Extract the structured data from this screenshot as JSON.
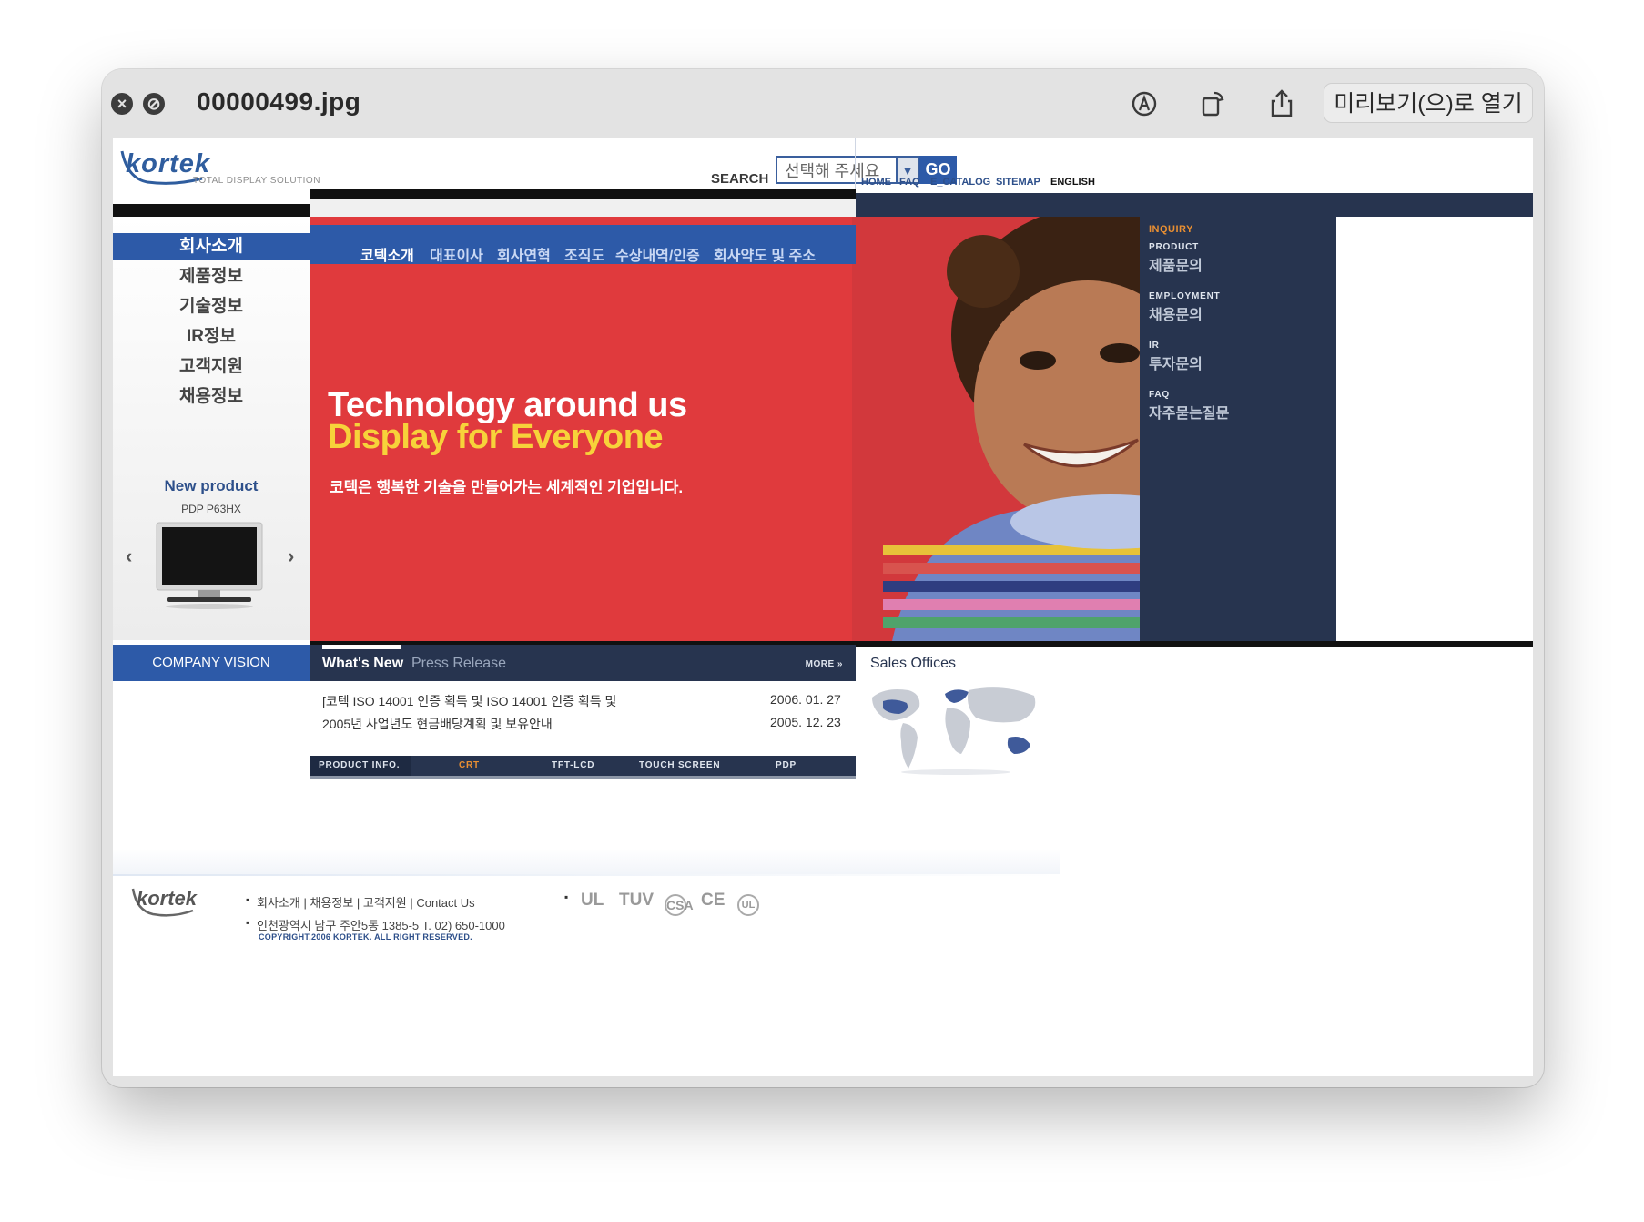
{
  "window": {
    "title": "00000499.jpg",
    "open_button": "미리보기(으)로 열기"
  },
  "header": {
    "logo": "kortek",
    "tagline": "TOTAL DISPLAY SOLUTION",
    "search_label": "SEARCH",
    "search_value": "선택해 주세요",
    "go_label": "GO",
    "links": [
      "HOME",
      "FAQ",
      "E_CATALOG",
      "SITEMAP",
      "ENGLISH"
    ]
  },
  "leftnav": {
    "items": [
      "회사소개",
      "제품정보",
      "기술정보",
      "IR정보",
      "고객지원",
      "채용정보"
    ],
    "active_index": 0,
    "new_product_title": "New product",
    "new_product_model": "PDP P63HX",
    "prev": "‹",
    "next": "›"
  },
  "hero": {
    "tabs": [
      "코텍소개",
      "대표이사",
      "회사연혁",
      "조직도",
      "수상내역/인증",
      "회사약도 및 주소"
    ],
    "headline_1": "Technology around us",
    "headline_2": "Display for Everyone",
    "subline": "코텍은 행복한 기술을 만들어가는 세계적인 기업입니다."
  },
  "inquiry": {
    "heading": "INQUIRY",
    "items": [
      {
        "en": "PRODUCT",
        "ko": "제품문의"
      },
      {
        "en": "EMPLOYMENT",
        "ko": "채용문의"
      },
      {
        "en": "IR",
        "ko": "투자문의"
      },
      {
        "en": "FAQ",
        "ko": "자주묻는질문"
      }
    ]
  },
  "vision": {
    "label": "COMPANY VISION"
  },
  "news": {
    "tab_active": "What's New",
    "tab_other": "Press Release",
    "more": "MORE »",
    "items": [
      {
        "title": "[코텍 ISO 14001 인증 획득 및 ISO 14001 인증 획득 및",
        "date": "2006. 01. 27"
      },
      {
        "title": "2005년 사업년도 현금배당계획 및 보유안내",
        "date": "2005. 12. 23"
      }
    ]
  },
  "product_bar": {
    "label": "PRODUCT INFO.",
    "items": [
      "CRT",
      "TFT-LCD",
      "TOUCH SCREEN",
      "PDP"
    ],
    "selected": "CRT"
  },
  "sales": {
    "title": "Sales Offices"
  },
  "footer": {
    "logo": "kortek",
    "links": "회사소개  |  채용정보  |  고객지원  |  Contact Us",
    "address": "인천광역시 남구 주안5동 1385-5   T. 02) 650-1000",
    "copyright": "COPYRIGHT.2006 KORTEK. ALL RIGHT RESERVED.",
    "certs": [
      "UL",
      "TUV",
      "CSA",
      "CE",
      "UL"
    ]
  },
  "colors": {
    "brand_blue": "#2d5aa8",
    "navy": "#27344f",
    "hero_red": "#e03a3d",
    "accent_yellow": "#f7d23a",
    "accent_orange": "#e98f32"
  }
}
